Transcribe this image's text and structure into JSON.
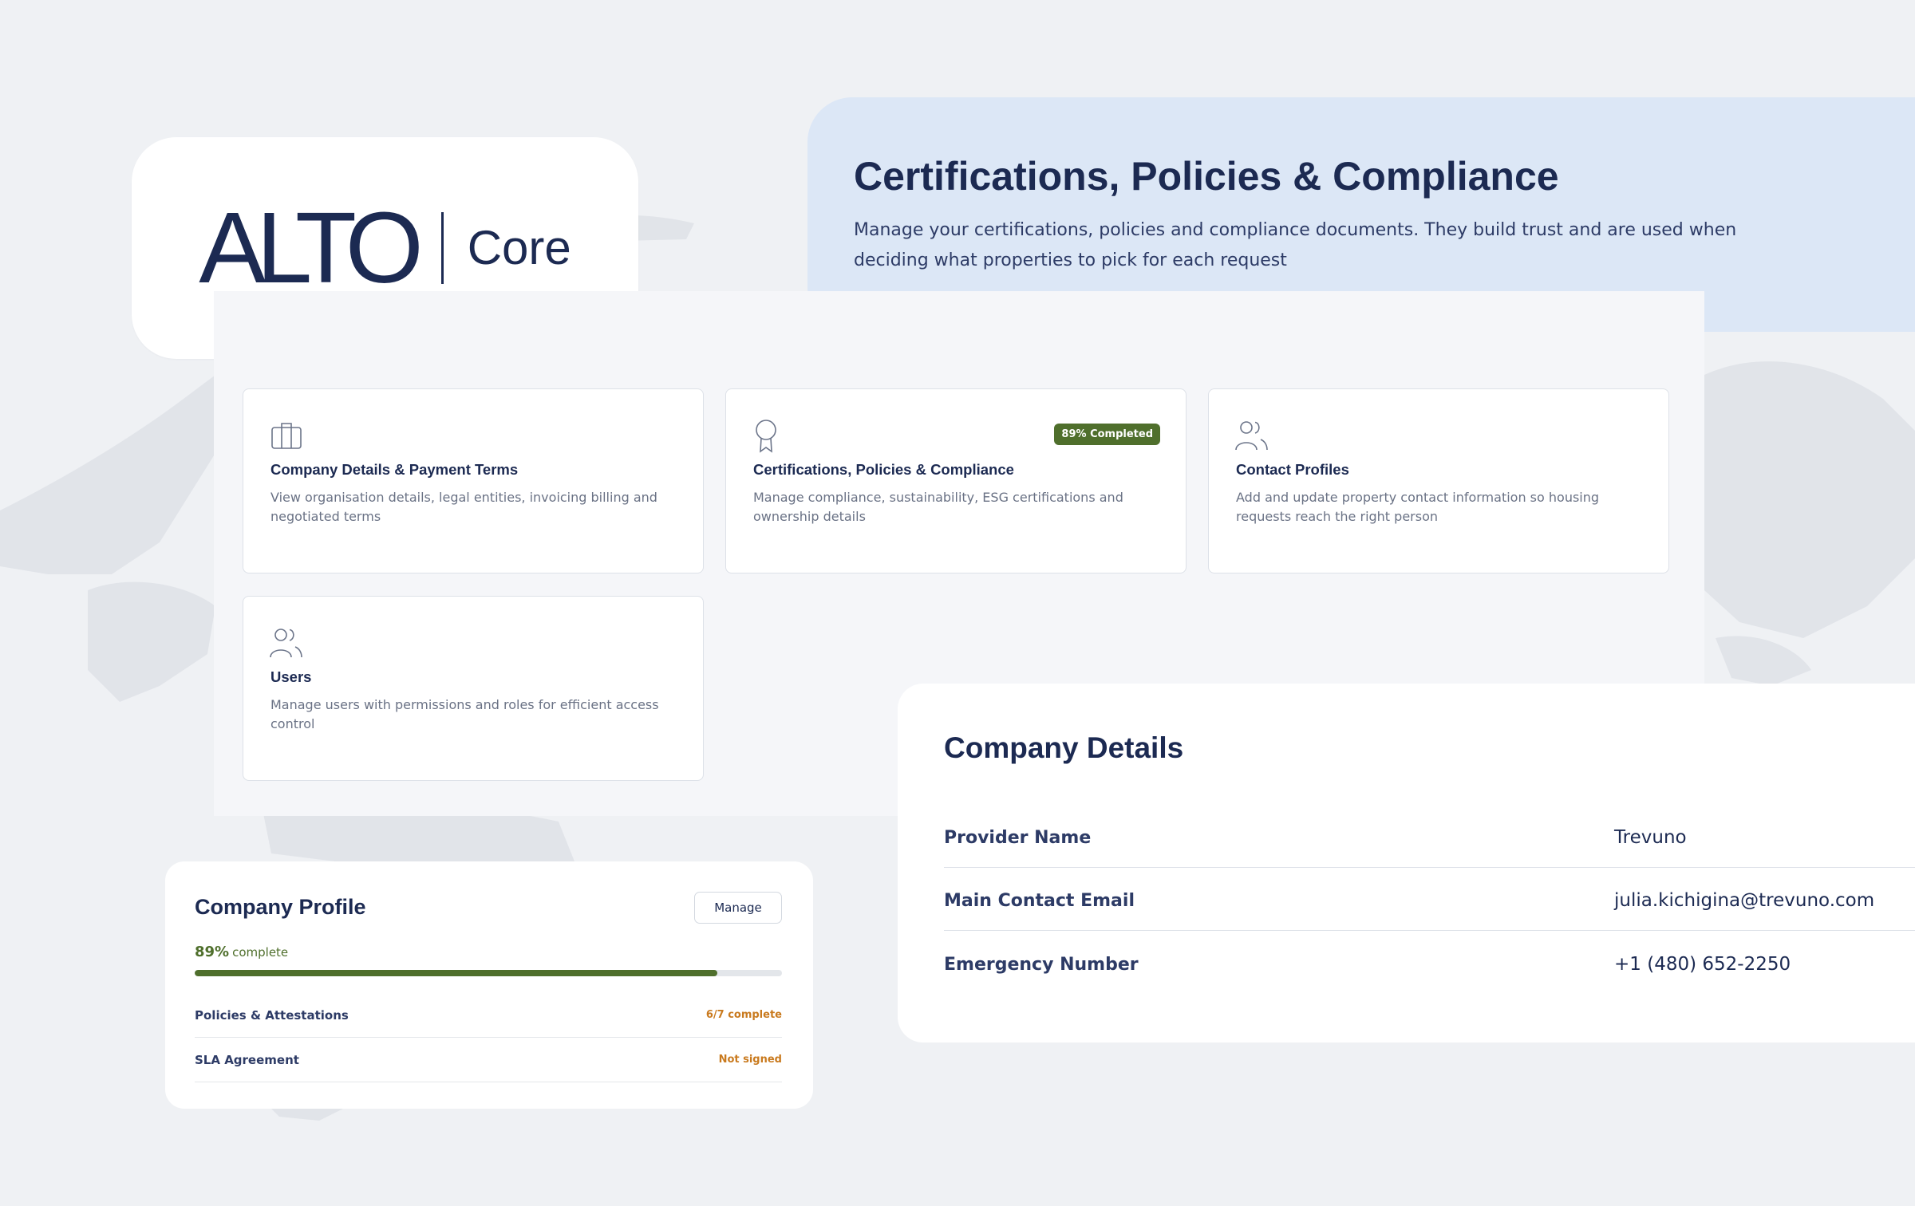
{
  "brand": {
    "mark": "ALTO",
    "product": "Core"
  },
  "banner": {
    "title": "Certifications, Policies & Compliance",
    "description": "Manage your certifications, policies and compliance documents. They build trust and are used when deciding what properties to pick for each request"
  },
  "cards": [
    {
      "icon": "briefcase-icon",
      "title": "Company Details & Payment Terms",
      "description": "View organisation details, legal entities, invoicing billing and negotiated terms"
    },
    {
      "icon": "award-ribbon-icon",
      "title": "Certifications, Policies & Compliance",
      "description": "Manage compliance, sustainability, ESG certifications and ownership details",
      "badge": "89% Completed"
    },
    {
      "icon": "users-icon",
      "title": "Contact Profiles",
      "description": "Add and update property contact information so housing requests reach the right person"
    },
    {
      "icon": "users-icon",
      "title": "Users",
      "description": "Manage users with permissions and roles for efficient access control"
    }
  ],
  "profile": {
    "title": "Company Profile",
    "manage_label": "Manage",
    "progress_pct": "89%",
    "progress_word": "complete",
    "progress_value": 0.89,
    "rows": [
      {
        "label": "Policies & Attestations",
        "status": "6/7 complete"
      },
      {
        "label": "SLA Agreement",
        "status": "Not signed"
      }
    ]
  },
  "details": {
    "title": "Company Details",
    "rows": [
      {
        "label": "Provider Name",
        "value": "Trevuno"
      },
      {
        "label": "Main Contact Email",
        "value": "julia.kichigina@trevuno.com"
      },
      {
        "label": "Emergency Number",
        "value": "+1 (480) 652-2250"
      }
    ]
  },
  "colors": {
    "background": "#eff1f4",
    "navy": "#1c2a52",
    "banner": "#dce7f6",
    "success": "#4f6f2c",
    "warning": "#c97a1e"
  }
}
